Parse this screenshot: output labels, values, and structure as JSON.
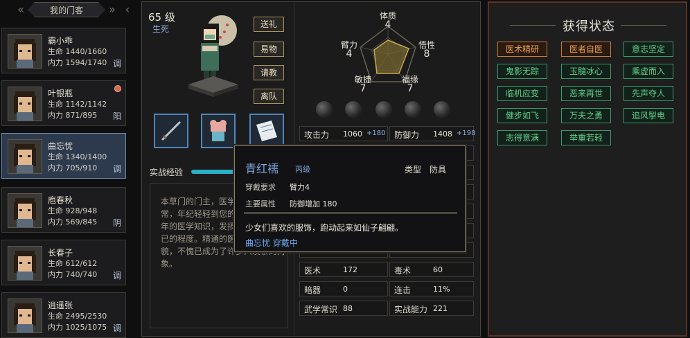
{
  "guests": {
    "tab_label": "我的门客",
    "list": [
      {
        "name": "霸小乖",
        "hp": "生命 1440/1660",
        "mp": "内力 1594/1740",
        "tag": "调",
        "selected": false
      },
      {
        "name": "叶银瓶",
        "hp": "生命 1142/1142",
        "mp": "内力 871/895",
        "tag": "阳",
        "selected": false
      },
      {
        "name": "曲忘忧",
        "hp": "生命 1340/1400",
        "mp": "内力 705/910",
        "tag": "调",
        "selected": true
      },
      {
        "name": "庖春秋",
        "hp": "生命 928/948",
        "mp": "内力 569/845",
        "tag": "阴",
        "selected": false
      },
      {
        "name": "长春子",
        "hp": "生命 612/612",
        "mp": "内力 740/740",
        "tag": "调",
        "selected": false
      },
      {
        "name": "逍遥张",
        "hp": "生命 2495/2530",
        "mp": "内力 1025/1075",
        "tag": "调",
        "selected": false
      }
    ]
  },
  "character": {
    "level": "65 级",
    "realm": "生死",
    "actions": [
      "送礼",
      "易物",
      "请教",
      "离队"
    ],
    "exp_label": "实战经验",
    "exp_fraction": 0.55,
    "bio": "本草门的门主，医学奇才，又异常，年纪轻轻到您的门下，门数百年的医学知识，发扬光大，达到了已的程度。精通的医术，天仙的美貌，不愧已成为了许多人羡慕的对象。"
  },
  "radar": {
    "top_label": "体质",
    "top_val": "4",
    "left_label": "臂力",
    "left_val": "4",
    "right_label": "悟性",
    "right_val": "8",
    "bottom_left_label": "敏捷",
    "bottom_left_val": "7",
    "bottom_right_label": "福缘",
    "bottom_right_val": "7"
  },
  "stats": {
    "attack": {
      "label": "攻击力",
      "value": "1060",
      "bonus": "+180"
    },
    "defense": {
      "label": "防御力",
      "value": "1408",
      "bonus": "+198"
    },
    "rows": [
      {
        "left_label": "",
        "left_val": "",
        "right_label": "",
        "right_val": ""
      },
      {
        "left_label": "",
        "left_val": "",
        "right_label": "",
        "right_val": ""
      },
      {
        "left_label": "",
        "left_val": "",
        "right_label": "",
        "right_val": ""
      },
      {
        "left_label": "",
        "left_val": "",
        "right_label": "",
        "right_val": ""
      },
      {
        "left_label": "",
        "left_val": "",
        "right_label": "",
        "right_val": ""
      },
      {
        "left_label": "",
        "left_val": "",
        "right_label": "",
        "right_val": ""
      },
      {
        "left_label": "医术",
        "left_val": "172",
        "right_label": "毒术",
        "right_val": "60"
      },
      {
        "left_label": "暗器",
        "left_val": "0",
        "right_label": "连击",
        "right_val": "11%"
      },
      {
        "left_label": "武学常识",
        "left_val": "88",
        "right_label": "实战能力",
        "right_val": "221"
      }
    ]
  },
  "tooltip": {
    "title": "青红襦",
    "grade": "丙级",
    "type_label": "类型",
    "type_value": "防具",
    "req_label": "穿戴要求",
    "req_value": "臂力4",
    "attr_label": "主要属性",
    "attr_value": "防御增加 180",
    "description": "少女们喜欢的服饰，跑动起来如仙子翩翩。",
    "wearer": "曲忘忧 穿戴中"
  },
  "status_panel": {
    "title": "获得状态",
    "badges": [
      {
        "label": "医术精研",
        "style": "orange"
      },
      {
        "label": "医者自医",
        "style": "orange"
      },
      {
        "label": "意志坚定",
        "style": "green"
      },
      {
        "label": "鬼影无踪",
        "style": "green"
      },
      {
        "label": "玉髓冰心",
        "style": "green"
      },
      {
        "label": "乘虚而入",
        "style": "green"
      },
      {
        "label": "临机应变",
        "style": "green"
      },
      {
        "label": "恶来再世",
        "style": "green"
      },
      {
        "label": "先声夺人",
        "style": "green"
      },
      {
        "label": "健步如飞",
        "style": "green"
      },
      {
        "label": "万夫之勇",
        "style": "green"
      },
      {
        "label": "追风掣电",
        "style": "green"
      },
      {
        "label": "志得意满",
        "style": "green"
      },
      {
        "label": "举重若轻",
        "style": "green"
      }
    ]
  }
}
